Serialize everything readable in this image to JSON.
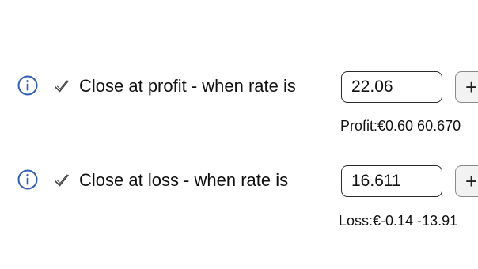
{
  "profit_row": {
    "label": "Close at profit - when rate is",
    "rate_value": "22.06",
    "plus_label": "+",
    "result_text": "Profit:€0.60 60.670"
  },
  "loss_row": {
    "label": "Close at loss - when rate is",
    "rate_value": "16.611",
    "plus_label": "+",
    "result_text": "Loss:€-0.14 -13.91"
  },
  "colors": {
    "info_icon": "#2f5fb3",
    "check_icon": "#444444",
    "input_border": "#2b2b2b",
    "button_bg": "#f2f2f2"
  },
  "icons": {
    "info": "info-circle-icon",
    "check": "checkmark-icon"
  }
}
